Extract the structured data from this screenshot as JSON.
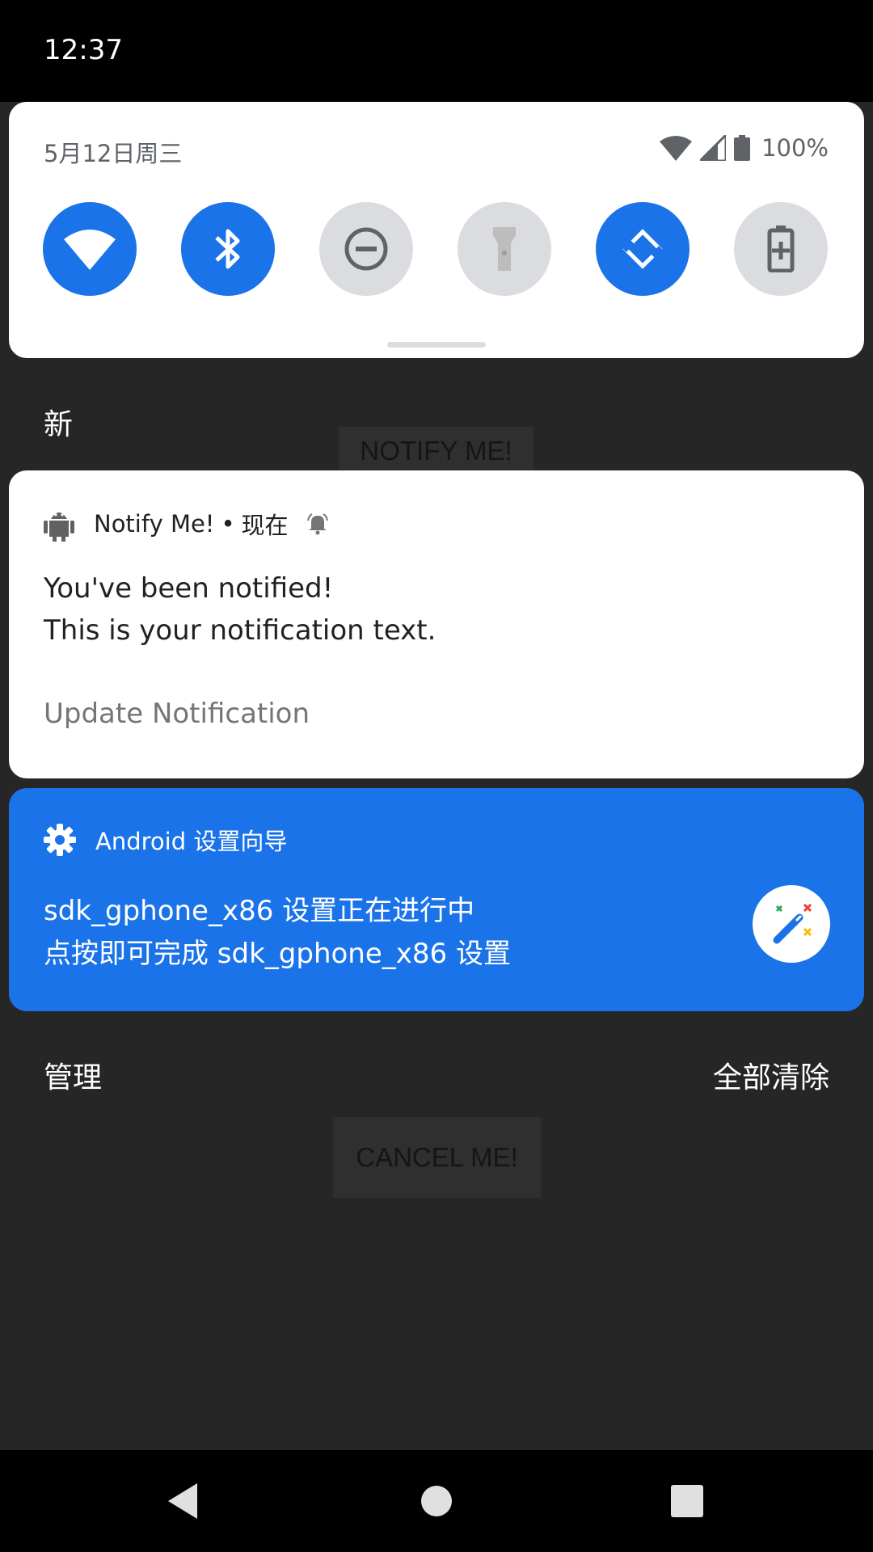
{
  "status_bar": {
    "time": "12:37"
  },
  "quick_settings": {
    "date": "5月12日周三",
    "battery_percent": "100%",
    "tiles": [
      {
        "name": "wifi",
        "icon": "wifi-icon",
        "active": true
      },
      {
        "name": "bluetooth",
        "icon": "bluetooth-icon",
        "active": true
      },
      {
        "name": "do-not-disturb",
        "icon": "dnd-icon",
        "active": false
      },
      {
        "name": "flashlight",
        "icon": "flashlight-icon",
        "active": false
      },
      {
        "name": "auto-rotate",
        "icon": "rotate-icon",
        "active": true
      },
      {
        "name": "battery-saver",
        "icon": "battery-saver-icon",
        "active": false
      }
    ],
    "accent_color": "#1a73e8"
  },
  "section_label": "新",
  "background_app": {
    "notify_button": "NOTIFY ME!",
    "cancel_button": "CANCEL ME!"
  },
  "notification": {
    "app_name": "Notify Me!",
    "separator": "•",
    "time": "现在",
    "title": "You've been notified!",
    "text": "This is your notification text.",
    "action": "Update Notification"
  },
  "setup_notification": {
    "app_name": "Android 设置向导",
    "title": "sdk_gphone_x86 设置正在进行中",
    "text": "点按即可完成 sdk_gphone_x86 设置"
  },
  "footer": {
    "manage": "管理",
    "clear_all": "全部清除"
  }
}
